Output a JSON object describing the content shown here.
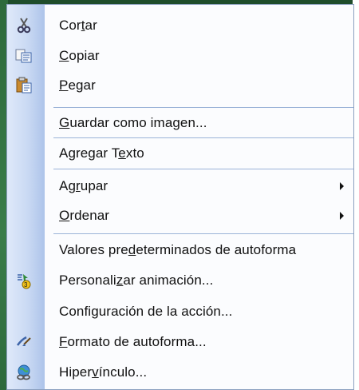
{
  "menu": {
    "items": [
      {
        "id": "cut",
        "pre": "Cor",
        "key": "t",
        "post": "ar",
        "icon": "scissors-icon"
      },
      {
        "id": "copy",
        "pre": "",
        "key": "C",
        "post": "opiar",
        "icon": "copy-icon"
      },
      {
        "id": "paste",
        "pre": "",
        "key": "P",
        "post": "egar",
        "icon": "paste-icon"
      },
      {
        "id": "save-as-image",
        "pre": "",
        "key": "G",
        "post": "uardar como imagen...",
        "icon": null
      },
      {
        "id": "add-text",
        "pre": "Agregar T",
        "key": "e",
        "post": "xto",
        "icon": null
      },
      {
        "id": "group",
        "pre": "Ag",
        "key": "r",
        "post": "upar",
        "icon": null,
        "submenu": true
      },
      {
        "id": "order",
        "pre": "",
        "key": "O",
        "post": "rdenar",
        "icon": null,
        "submenu": true
      },
      {
        "id": "autoshape-defaults",
        "pre": "Valores pre",
        "key": "d",
        "post": "eterminados de autoforma",
        "icon": null
      },
      {
        "id": "custom-animation",
        "pre": "Personali",
        "key": "z",
        "post": "ar animación...",
        "icon": "animation-icon"
      },
      {
        "id": "action-settings",
        "pre": "Confi",
        "key": "g",
        "post": "uración de la acción...",
        "icon": null
      },
      {
        "id": "format-autoshape",
        "pre": "",
        "key": "F",
        "post": "ormato de autoforma...",
        "icon": "format-brush-icon"
      },
      {
        "id": "hyperlink",
        "pre": "Hiper",
        "key": "v",
        "post": "ínculo...",
        "icon": "hyperlink-icon"
      }
    ]
  }
}
